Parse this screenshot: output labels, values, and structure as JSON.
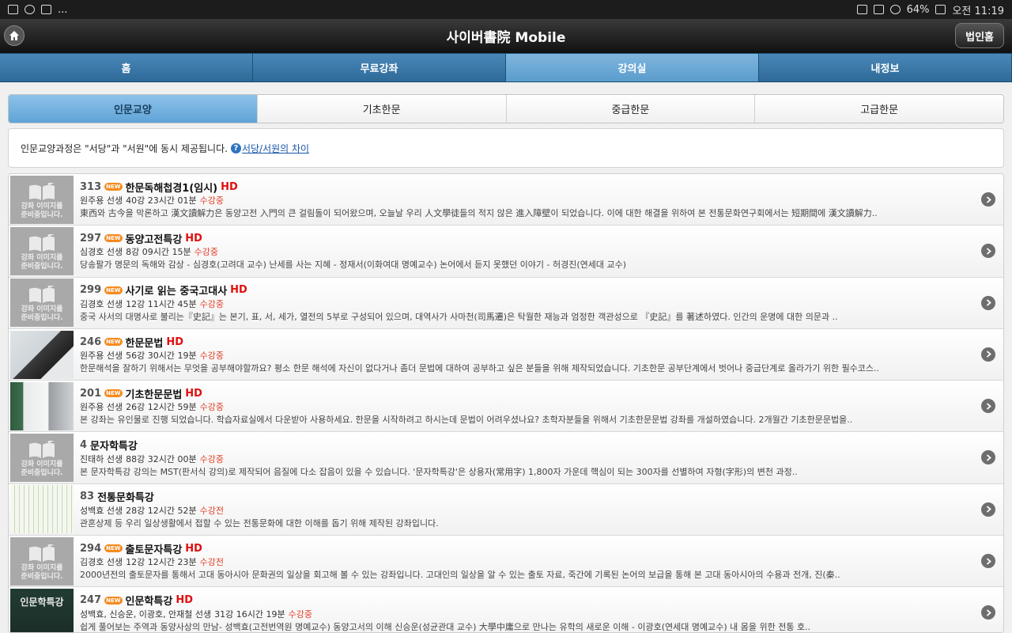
{
  "statusbar": {
    "ellipsis": "...",
    "battery": "64%",
    "time": "오전 11:19"
  },
  "header": {
    "title": "사이버書院 Mobile",
    "corp_button": "법인홈"
  },
  "main_tabs": [
    {
      "label": "홈"
    },
    {
      "label": "무료강좌"
    },
    {
      "label": "강의실"
    },
    {
      "label": "내정보"
    }
  ],
  "sub_tabs": [
    {
      "label": "인문교양"
    },
    {
      "label": "기초한문"
    },
    {
      "label": "중급한문"
    },
    {
      "label": "고급한문"
    }
  ],
  "notice": {
    "text": "인문교양과정은 \"서당\"과 \"서원\"에 동시 제공됩니다.",
    "link": "서당/서원의 차이"
  },
  "placeholder_text": {
    "line1": "강좌 이미지를",
    "line2": "준비중입니다."
  },
  "photo_d_text": "인문학특강",
  "badge_new": "NEW",
  "badge_hd": "HD",
  "courses": [
    {
      "num": "313",
      "title": "한문독해첩경1(임시)",
      "teacher": "원주용 선생",
      "meta": "40강 23시간 01분",
      "status": "수강중",
      "desc": "東西와 古今을 막론하고 漢文讀解力은 동양고전 入門의 큰 걸림돌이 되어왔으며, 오늘날 우리 人文學徒들의 적지 않은 進入障壁이 되었습니다. 이에 대한 해결을 위하여 본 전통문화연구회에서는 短期間에 漢文讀解力.."
    },
    {
      "num": "297",
      "title": "동양고전특강",
      "teacher": "심경호 선생",
      "meta": "8강 09시간 15분",
      "status": "수강중",
      "desc": "당송팔가 명문의 독해와 감상 - 심경호(고려대 교수) 난세를 사는 지혜 - 정재서(이화여대 명예교수) 논어에서 듣지 못했던 이야기 - 허경진(연세대 교수)"
    },
    {
      "num": "299",
      "title": "사기로 읽는 중국고대사",
      "teacher": "김경호 선생",
      "meta": "12강 11시간 45분",
      "status": "수강중",
      "desc": "중국 사서의 대명사로 불리는『史記』는 본기, 표, 서, 세가, 열전의 5부로 구성되어 있으며, 대역사가 사마천(司馬遷)은 탁월한 재능과 엄정한 객관성으로 『史記』를 著述하였다. 인간의 운명에 대한 의문과 .."
    },
    {
      "num": "246",
      "title": "한문문법",
      "teacher": "원주용 선생",
      "meta": "56강 30시간 19분",
      "status": "수강중",
      "desc": "한문해석을 잘하기 위해서는 무엇을 공부해야할까요? 평소 한문 해석에 자신이 없다거나 좀더 문법에 대하여 공부하고 싶은 분들을 위해 제작되었습니다. 기초한문 공부단계에서 벗어나 중급단계로 올라가기 위한 필수코스.."
    },
    {
      "num": "201",
      "title": "기초한문문법",
      "teacher": "원주용 선생",
      "meta": "26강 12시간 59분",
      "status": "수강중",
      "desc": "본 강좌는 유인물로 진행 되었습니다. 학습자료실에서 다운받아 사용하세요. 한문을 시작하려고 하시는데 문법이 어려우셨나요? 초학자분들을 위해서 기초한문문법 강좌를 개설하였습니다. 2개월간 기초한문문법을.."
    },
    {
      "num": "4",
      "title": "문자학특강",
      "teacher": "진태하 선생",
      "meta": "88강 32시간 00분",
      "status": "수강중",
      "desc": "본 문자학특강 강의는 MST(판서식 강의)로 제작되어 음질에 다소 잡음이 있을 수 있습니다. '문자학특강'은 상용자(常用字) 1,800자 가운데 핵심이 되는 300자를 선별하여 자형(字形)의 변천 과정.."
    },
    {
      "num": "83",
      "title": "전통문화특강",
      "teacher": "성백효 선생",
      "meta": "28강 12시간 52분",
      "status": "수강전",
      "desc": "관혼상제 등 우리 일상생활에서 접할 수 있는 전통문화에 대한 이해를 돕기 위해 제작된 강좌입니다."
    },
    {
      "num": "294",
      "title": "출토문자특강",
      "teacher": "김경호 선생",
      "meta": "12강 12시간 23분",
      "status": "수강전",
      "desc": "2000년전의 출토문자를 통해서 고대 동아시아 문화권의 일상을 회고해 볼 수 있는 강좌입니다. 고대인의 일상을 알 수 있는 출토 자료, 죽간에 기록된 논어의 보급을 통해 본 고대 동아시아의 수용과 전개, 진(秦.."
    },
    {
      "num": "247",
      "title": "인문학특강",
      "teacher": "성백효, 신승운, 이광호, 안재철 선생",
      "meta": "31강 16시간 19분",
      "status": "수강중",
      "desc": "쉽게 풀어보는 주역과 동양사상의 만남- 성백효(고전번역원 명예교수) 동양고서의 이해 신승운(성균관대 교수) 大學中庸으로 만나는 유학의 새로운 이해 - 이광호(연세대 명예교수) 내 몸을 위한 전통 호.."
    }
  ],
  "colors": {
    "accent_tab": "#5a9ccc",
    "status": "#e0402a",
    "hd": "#e01010",
    "new": "#f58a1f"
  }
}
